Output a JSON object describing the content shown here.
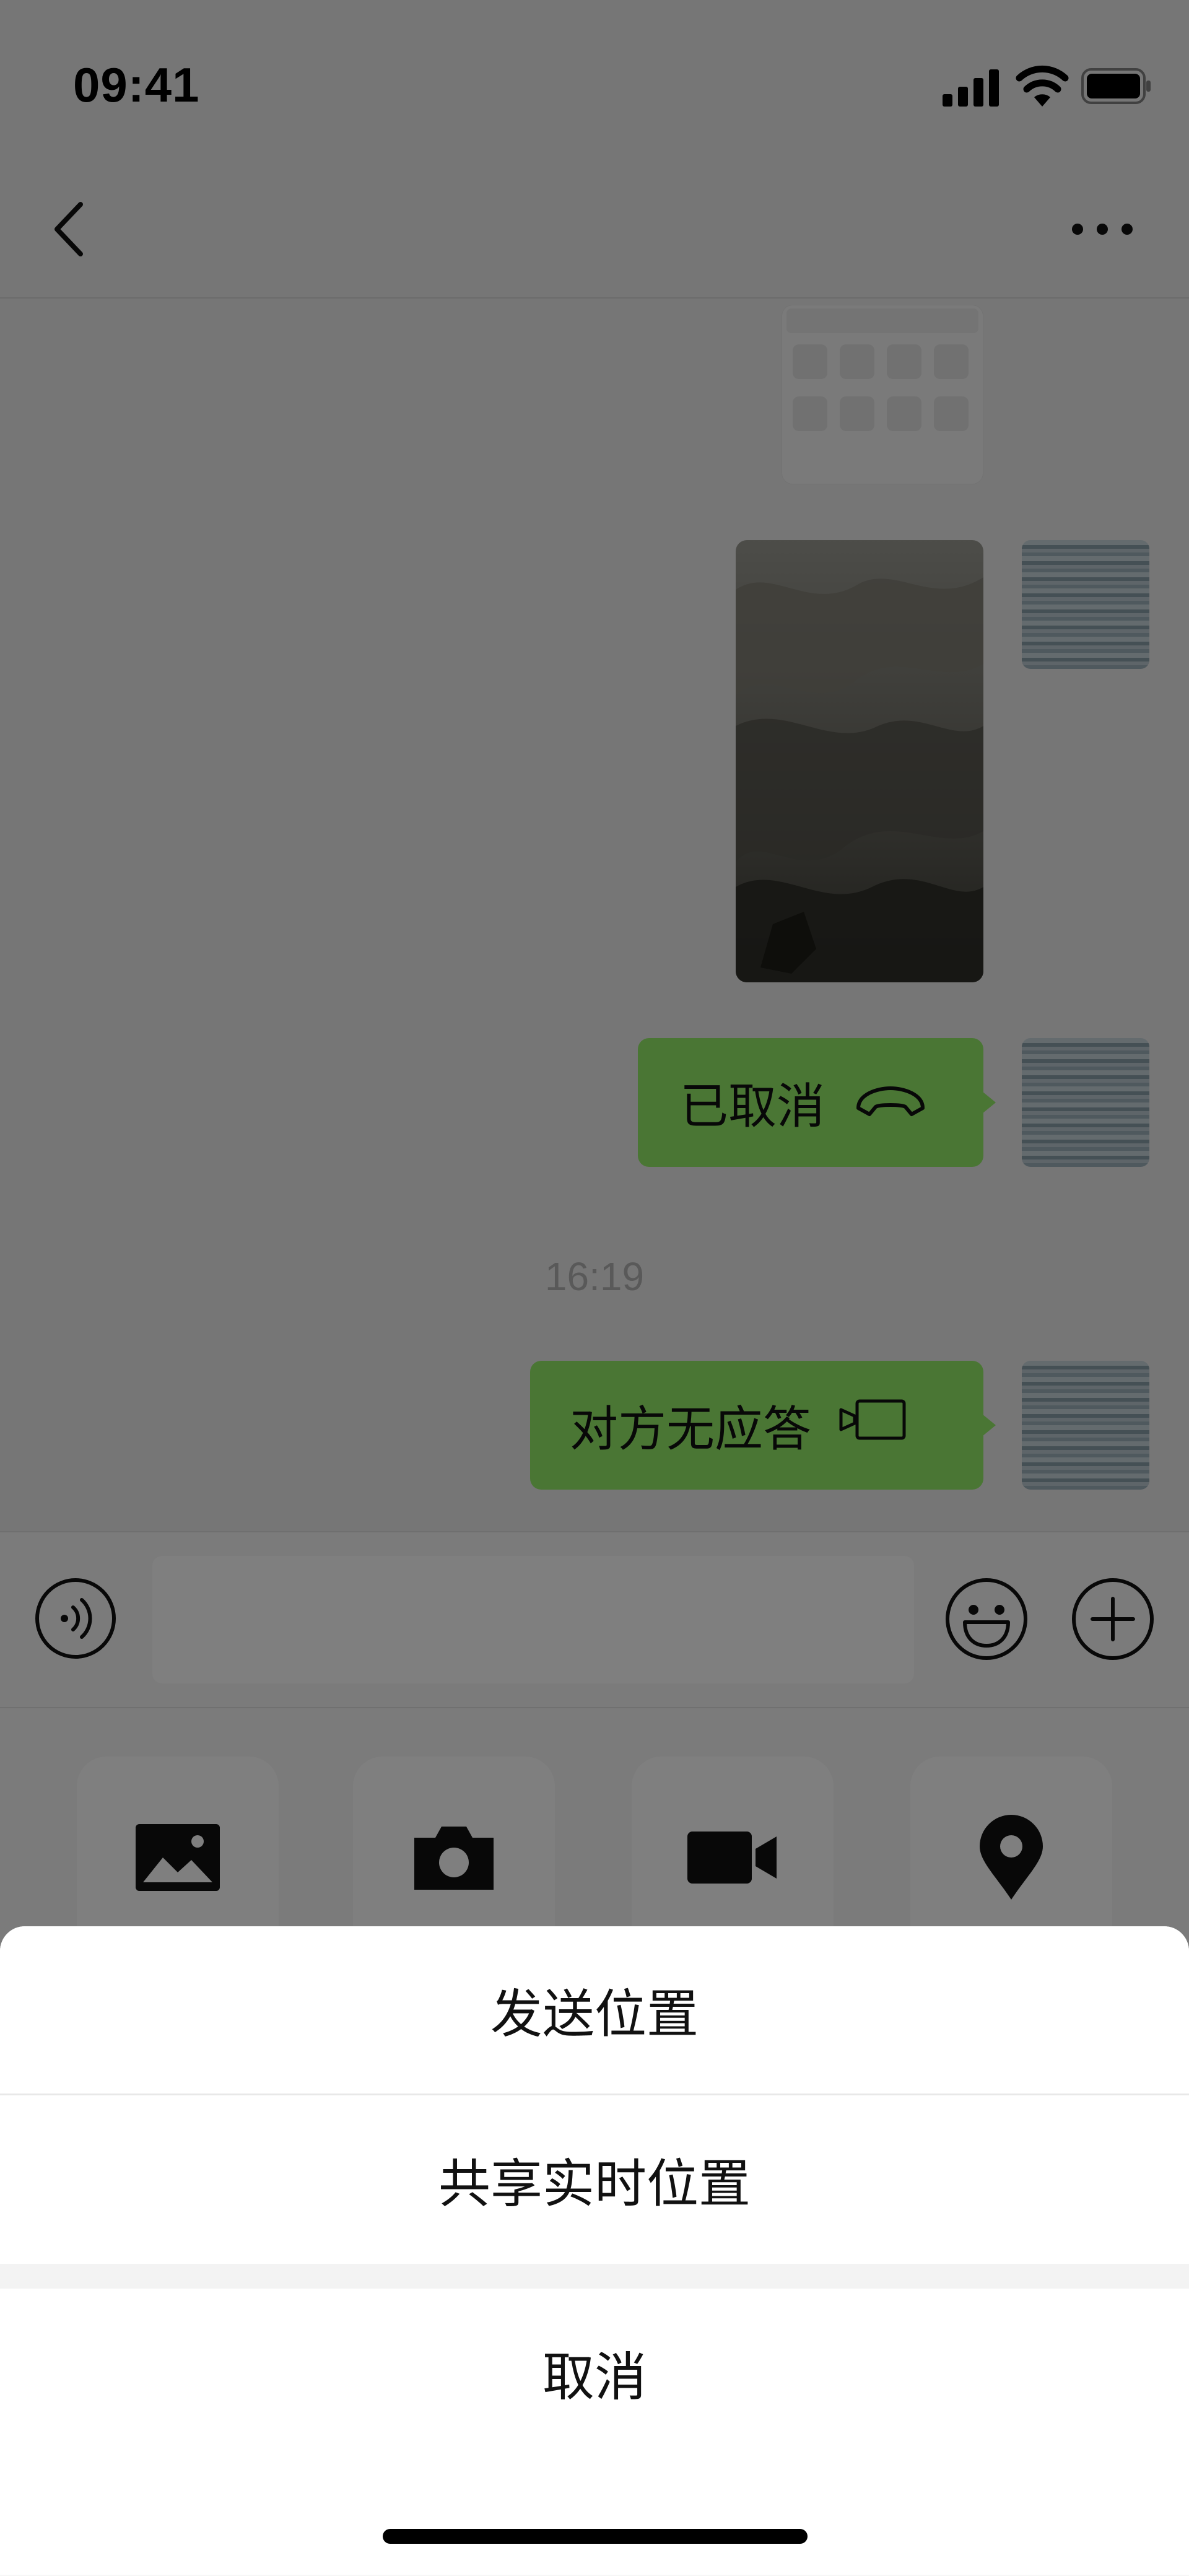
{
  "status_bar": {
    "time": "09:41"
  },
  "chat": {
    "messages": [
      {
        "type": "image",
        "kind": "screenshot-thumbnail",
        "sender": "self"
      },
      {
        "type": "image",
        "kind": "photo",
        "sender": "self"
      },
      {
        "type": "call",
        "text": "已取消",
        "icon": "phone-hangup-icon",
        "sender": "self"
      },
      {
        "type": "timestamp",
        "text": "16:19"
      },
      {
        "type": "call",
        "text": "对方无应答",
        "icon": "video-call-icon",
        "sender": "self"
      }
    ]
  },
  "input_bar": {
    "value": "",
    "placeholder": ""
  },
  "tool_panel": {
    "tools": [
      {
        "icon": "image-icon"
      },
      {
        "icon": "camera-icon"
      },
      {
        "icon": "video-icon"
      },
      {
        "icon": "location-icon"
      }
    ]
  },
  "action_sheet": {
    "options": [
      "发送位置",
      "共享实时位置"
    ],
    "cancel_label": "取消"
  },
  "colors": {
    "bubble": "#95ec69",
    "background": "#ededed",
    "overlay": "rgba(0,0,0,0.5)"
  }
}
